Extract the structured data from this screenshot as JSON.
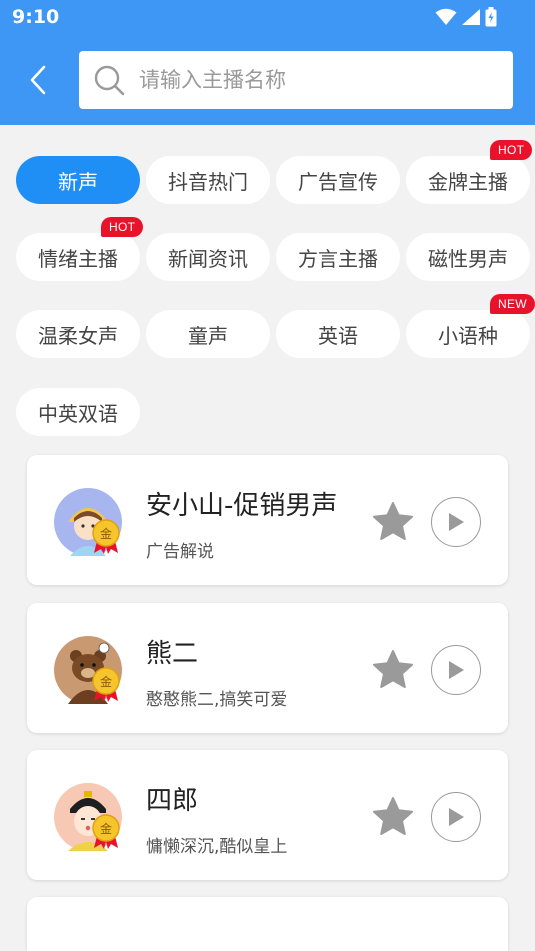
{
  "status_bar": {
    "time": "9:10"
  },
  "search": {
    "placeholder": "请输入主播名称",
    "value": ""
  },
  "categories": [
    {
      "label": "新声",
      "active": true
    },
    {
      "label": "抖音热门"
    },
    {
      "label": "广告宣传"
    },
    {
      "label": "金牌主播",
      "badge": "HOT"
    },
    {
      "label": "情绪主播",
      "badge": "HOT"
    },
    {
      "label": "新闻资讯"
    },
    {
      "label": "方言主播"
    },
    {
      "label": "磁性男声"
    },
    {
      "label": "温柔女声"
    },
    {
      "label": "童声"
    },
    {
      "label": "英语"
    },
    {
      "label": "小语种",
      "badge": "NEW"
    },
    {
      "label": "中英双语"
    }
  ],
  "anchors": [
    {
      "name": "安小山-促销男声",
      "desc": "广告解说",
      "medal": "金"
    },
    {
      "name": "熊二",
      "desc": "憨憨熊二,搞笑可爱",
      "medal": "金"
    },
    {
      "name": "四郎",
      "desc": "慵懒深沉,酷似皇上",
      "medal": "金"
    }
  ],
  "colors": {
    "header": "#3f97f5",
    "active_chip": "#1f8ff5",
    "badge": "#e8132b",
    "star": "#9a9a9a",
    "background": "#f2f2f2"
  },
  "icons": [
    "wifi-icon",
    "signal-icon",
    "battery-icon",
    "back-icon",
    "search-icon",
    "star-icon",
    "play-icon",
    "medal-icon"
  ]
}
